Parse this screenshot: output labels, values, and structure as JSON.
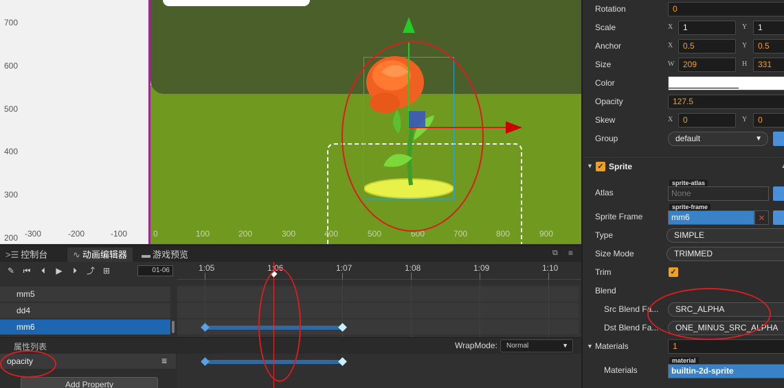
{
  "scene": {
    "ruler_v": [
      "700",
      "600",
      "500",
      "400",
      "300",
      "200"
    ],
    "ruler_h": [
      "-300",
      "-200",
      "-100",
      "0",
      "100",
      "200",
      "300",
      "400",
      "500",
      "600",
      "700",
      "800",
      "900"
    ]
  },
  "bottom_tabs": [
    {
      "label": "控制台",
      "icon": "console-icon"
    },
    {
      "label": "动画编辑器",
      "icon": "animation-icon"
    },
    {
      "label": "游戏预览",
      "icon": "game-preview-icon"
    }
  ],
  "anim": {
    "frame_field": "01-06",
    "ticks": [
      "1:05",
      "1:06",
      "1:07",
      "1:08",
      "1:09",
      "1:10"
    ],
    "nodes": [
      "mm5",
      "dd4",
      "mm6"
    ],
    "property_list_title": "属性列表",
    "wrap_mode_label": "WrapMode:",
    "wrap_mode_value": "Normal",
    "property_name": "opacity",
    "add_property": "Add Property"
  },
  "inspector": {
    "rotation": {
      "label": "Rotation",
      "value": "0"
    },
    "scale": {
      "label": "Scale",
      "x": "1",
      "y": "1"
    },
    "anchor": {
      "label": "Anchor",
      "x": "0.5",
      "y": "0.5"
    },
    "size": {
      "label": "Size",
      "w": "209",
      "h": "331"
    },
    "color": {
      "label": "Color",
      "value": "#ffffff"
    },
    "opacity": {
      "label": "Opacity",
      "value": "127.5"
    },
    "skew": {
      "label": "Skew",
      "x": "0",
      "y": "0"
    },
    "group": {
      "label": "Group",
      "value": "default"
    },
    "axis_labels": {
      "x": "X",
      "y": "Y",
      "w": "W",
      "h": "H"
    },
    "sprite": {
      "title": "Sprite",
      "atlas": {
        "label": "Atlas",
        "tag": "sprite-atlas",
        "value": "None"
      },
      "sprite_frame": {
        "label": "Sprite Frame",
        "tag": "sprite-frame",
        "value": "mm6"
      },
      "type": {
        "label": "Type",
        "value": "SIMPLE"
      },
      "size_mode": {
        "label": "Size Mode",
        "value": "TRIMMED"
      },
      "trim": {
        "label": "Trim",
        "checked": true
      },
      "blend": {
        "label": "Blend"
      },
      "src_blend": {
        "label": "Src Blend Fa...",
        "value": "SRC_ALPHA"
      },
      "dst_blend": {
        "label": "Dst Blend Fa...",
        "value": "ONE_MINUS_SRC_ALPHA"
      },
      "materials": {
        "label": "Materials",
        "count": "1"
      },
      "materials_item": {
        "label": "Materials",
        "tag": "material",
        "value": "builtin-2d-sprite"
      }
    }
  },
  "colors": {
    "accent_orange": "#f0a020",
    "selection_blue": "#1f66b0",
    "annotation_red": "#d81e1e",
    "canvas_green": "#70991f"
  }
}
